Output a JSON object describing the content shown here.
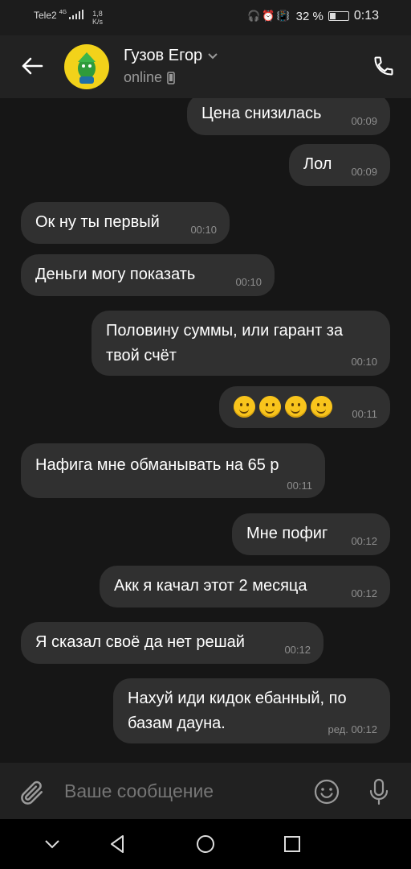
{
  "status_bar": {
    "carrier": "Tele2",
    "network": "4G",
    "speed_value": "1,8",
    "speed_unit": "K/s",
    "battery": "32 %",
    "time": "0:13"
  },
  "header": {
    "name": "Гузов Егор",
    "status": "online"
  },
  "messages": [
    {
      "text": "Цена снизилась",
      "time": "00:09",
      "side": "out"
    },
    {
      "text": "Лол",
      "time": "00:09",
      "side": "out"
    },
    {
      "text": "Ок ну ты первый",
      "time": "00:10",
      "side": "in"
    },
    {
      "text": "Деньги могу показать",
      "time": "00:10",
      "side": "in"
    },
    {
      "text": "Половину суммы, или гарант за твой счёт",
      "time": "00:10",
      "side": "out"
    },
    {
      "text": "",
      "emoji_count": 4,
      "time": "00:11",
      "side": "out"
    },
    {
      "text": "Нафига мне обманывать на 65 р",
      "time": "00:11",
      "side": "in"
    },
    {
      "text": "Мне пофиг",
      "time": "00:12",
      "side": "out"
    },
    {
      "text": "Акк я качал этот 2 месяца",
      "time": "00:12",
      "side": "out"
    },
    {
      "text": "Я сказал своё да нет решай",
      "time": "00:12",
      "side": "in"
    },
    {
      "text": "Нахуй иди кидок ебанный, по базам дауна.",
      "time": "ред. 00:12",
      "side": "out"
    }
  ],
  "composer": {
    "placeholder": "Ваше сообщение"
  },
  "colors": {
    "background": "#161616",
    "bubble": "#303030",
    "header": "#222222",
    "time_text": "#8e8e8e"
  }
}
